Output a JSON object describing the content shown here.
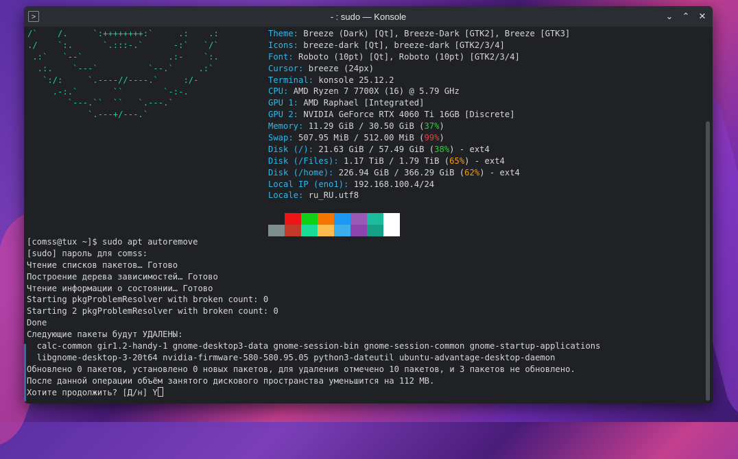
{
  "window": {
    "title": "- : sudo — Konsole"
  },
  "logo_art": "/`    /.     `:++++++++:`     .:    .:\n./    `:.      `.:::-.`      -:`   `/`\n .:`   `--`                 .:-    `:.\n  .:.    `---`          `--.`     .:`\n   `:/:     `.----//----.`     :/-\n     .-:.`       ``        `-:-.\n        `---.``  ``   `.---.`\n            `.---+/---.`",
  "sysinfo": {
    "rows": [
      {
        "key": "Theme:",
        "val": "Breeze (Dark) [Qt], Breeze-Dark [GTK2], Breeze [GTK3]"
      },
      {
        "key": "Icons:",
        "val": "breeze-dark [Qt], breeze-dark [GTK2/3/4]"
      },
      {
        "key": "Font:",
        "val": "Roboto (10pt) [Qt], Roboto (10pt) [GTK2/3/4]"
      },
      {
        "key": "Cursor:",
        "val": "breeze (24px)"
      },
      {
        "key": "Terminal:",
        "val": "konsole 25.12.2"
      },
      {
        "key": "CPU:",
        "val": "AMD Ryzen 7 7700X (16) @ 5.79 GHz"
      },
      {
        "key": "GPU 1:",
        "val": "AMD Raphael [Integrated]"
      },
      {
        "key": "GPU 2:",
        "val": "NVIDIA GeForce RTX 4060 Ti 16GB [Discrete]"
      },
      {
        "key": "Memory:",
        "val": "11.29 GiB / 30.50 GiB (",
        "pct": "37%",
        "pct_color": "green",
        "tail": ")"
      },
      {
        "key": "Swap:",
        "val": "507.95 MiB / 512.00 MiB (",
        "pct": "99%",
        "pct_color": "red",
        "tail": ")"
      },
      {
        "key": "Disk (/):",
        "val": "21.63 GiB / 57.49 GiB (",
        "pct": "38%",
        "pct_color": "green",
        "tail": ") - ext4"
      },
      {
        "key": "Disk (/Files):",
        "val": "1.17 TiB / 1.79 TiB (",
        "pct": "65%",
        "pct_color": "orange",
        "tail": ") - ext4"
      },
      {
        "key": "Disk (/home):",
        "val": "226.94 GiB / 366.29 GiB (",
        "pct": "62%",
        "pct_color": "orange",
        "tail": ") - ext4"
      },
      {
        "key": "Local IP (eno1):",
        "val": "192.168.100.4/24"
      },
      {
        "key": "Locale:",
        "val": "ru_RU.utf8"
      }
    ]
  },
  "colors": {
    "key": "#2fb8ea",
    "logo": "#1fcf9a",
    "green": "#2ecc40",
    "red": "#e0443c",
    "orange": "#f39c12",
    "palette_top": [
      "#1f2125",
      "#ed1515",
      "#11d116",
      "#f67400",
      "#1d99f3",
      "#9b59b6",
      "#1abc9c",
      "#ffffff"
    ],
    "palette_bottom": [
      "#7f8c8d",
      "#c0392b",
      "#1cdc9a",
      "#fdbc4b",
      "#3daee9",
      "#8e44ad",
      "#16a085",
      "#ffffff"
    ]
  },
  "output": {
    "lines": [
      "[comss@tux ~]$ sudo apt autoremove",
      "[sudo] пароль для comss:",
      "Чтение списков пакетов… Готово",
      "Построение дерева зависимостей… Готово",
      "Чтение информации о состоянии… Готово",
      "Starting pkgProblemResolver with broken count: 0",
      "Starting 2 pkgProblemResolver with broken count: 0",
      "Done",
      "Следующие пакеты будут УДАЛЕНЫ:",
      "  calc-common gir1.2-handy-1 gnome-desktop3-data gnome-session-bin gnome-session-common gnome-startup-applications",
      "  libgnome-desktop-3-20t64 nvidia-firmware-580-580.95.05 python3-dateutil ubuntu-advantage-desktop-daemon",
      "Обновлено 0 пакетов, установлено 0 новых пакетов, для удаления отмечено 10 пакетов, и 3 пакетов не обновлено.",
      "После данной операции объём занятого дискового пространства уменьшится на 112 MB."
    ],
    "prompt": "Хотите продолжить? [Д/н] Y"
  }
}
